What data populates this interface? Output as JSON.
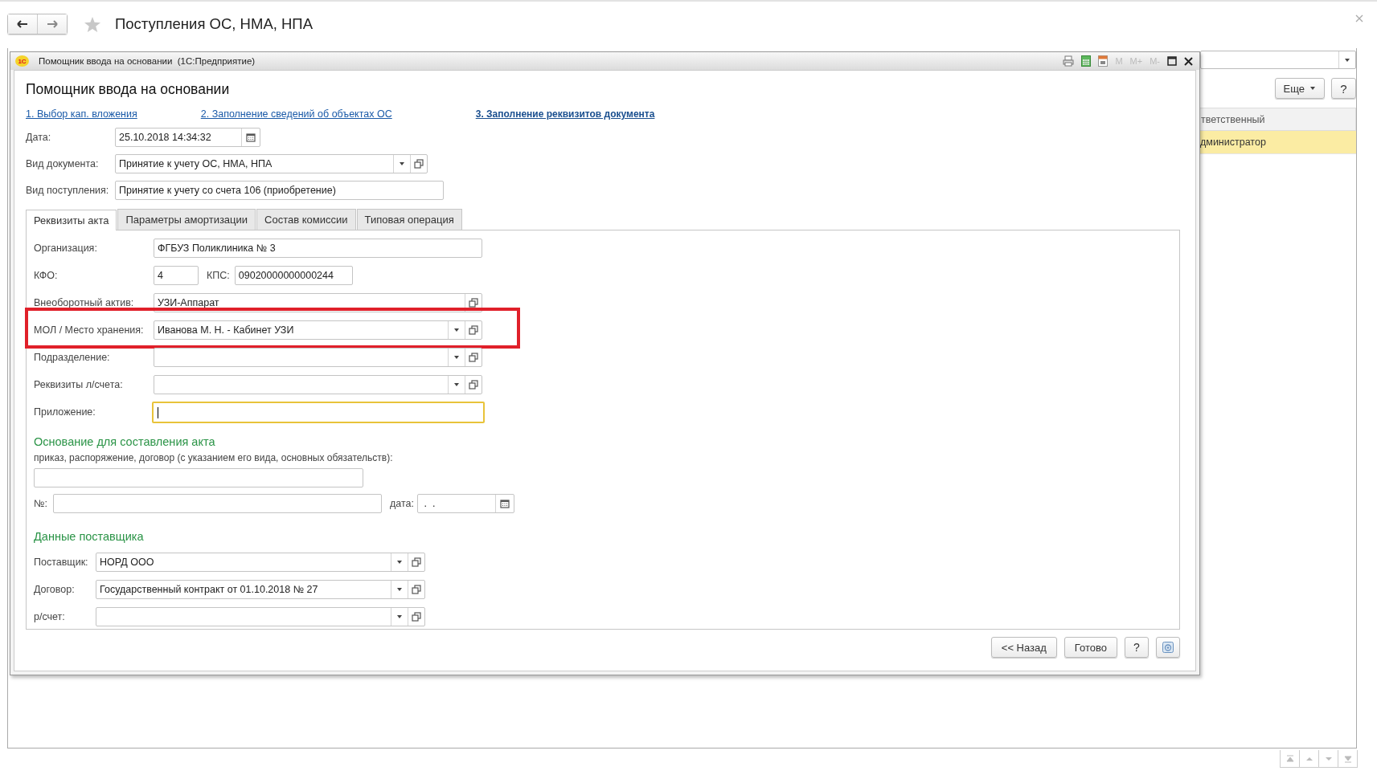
{
  "main": {
    "title": "Поступления ОС, НМА, НПА",
    "favorite": false
  },
  "list": {
    "more_button": "Еще",
    "help_button": "?",
    "columns": [
      "тветственный"
    ],
    "rows": [
      {
        "cells": [
          "дминистратор"
        ],
        "selected": true
      }
    ]
  },
  "dialog": {
    "app_logo": "1С",
    "window_title": "Помощник ввода на основании  (1С:Предприятие)",
    "memory_buttons": [
      "M",
      "M+",
      "M-"
    ],
    "title": "Помощник ввода на основании",
    "steps": [
      {
        "label": "1. Выбор кап. вложения",
        "current": false
      },
      {
        "label": "2. Заполнение сведений об объектах ОС",
        "current": false
      },
      {
        "label": "3. Заполнение реквизитов документа",
        "current": true
      }
    ],
    "header_fields": [
      {
        "kind": "date",
        "label": "Дата:",
        "value": "25.10.2018 14:34:32"
      },
      {
        "kind": "choice",
        "label": "Вид документа:",
        "value": "Принятие к учету ОС, НМА, НПА",
        "dropdown": true,
        "open_button": true
      },
      {
        "kind": "text",
        "label": "Вид поступления:",
        "value": "Принятие к учету со счета 106 (приобретение)"
      }
    ],
    "tabs": [
      {
        "label": "Реквизиты акта",
        "selected": true
      },
      {
        "label": "Параметры амортизации",
        "selected": false
      },
      {
        "label": "Состав комиссии",
        "selected": false
      },
      {
        "label": "Типовая операция",
        "selected": false
      }
    ],
    "tab_fields": [
      {
        "kind": "text",
        "label": "Организация:",
        "value": "ФГБУЗ Поликлиника № 3",
        "focused": false,
        "highlighted": false
      },
      {
        "kind": "pair",
        "label": "КФО:",
        "value": "4",
        "second_label": "КПС:",
        "second_value": "09020000000000244",
        "focused": false,
        "highlighted": false
      },
      {
        "kind": "choice",
        "label": "Внеоборотный актив:",
        "value": "УЗИ-Аппарат",
        "dropdown": false,
        "open_button": true,
        "focused": false,
        "highlighted": false
      },
      {
        "kind": "choice",
        "label": "МОЛ / Место хранения:",
        "value": "Иванова М. Н. - Кабинет УЗИ",
        "dropdown": true,
        "open_button": true,
        "focused": false,
        "highlighted": true
      },
      {
        "kind": "choice",
        "label": "Подразделение:",
        "dropdown": true,
        "open_button": true,
        "focused": false,
        "highlighted": false
      },
      {
        "kind": "choice",
        "label": "Реквизиты л/счета:",
        "dropdown": true,
        "open_button": true,
        "focused": false,
        "highlighted": false
      },
      {
        "kind": "text",
        "label": "Приложение:",
        "focused": true,
        "highlighted": false
      }
    ],
    "basis": {
      "heading": "Основание для составления акта",
      "hint": "приказ, распоряжение, договор (с указанием его вида, основных обязательств):",
      "number_label": "№:",
      "date_label": "дата:",
      "date_value": " .  ."
    },
    "supplier": {
      "heading": "Данные поставщика",
      "fields": [
        {
          "label": "Поставщик:",
          "value": "НОРД ООО",
          "dropdown": true,
          "open_button": true
        },
        {
          "label": "Договор:",
          "value": "Государственный контракт от 01.10.2018 № 27",
          "dropdown": true,
          "open_button": true
        },
        {
          "label": "р/счет:",
          "dropdown": true,
          "open_button": true
        }
      ]
    },
    "buttons": [
      {
        "kind": "text",
        "label": "<< Назад"
      },
      {
        "kind": "text",
        "label": "Готово"
      },
      {
        "kind": "text",
        "label": "?"
      },
      {
        "kind": "settings"
      }
    ]
  }
}
